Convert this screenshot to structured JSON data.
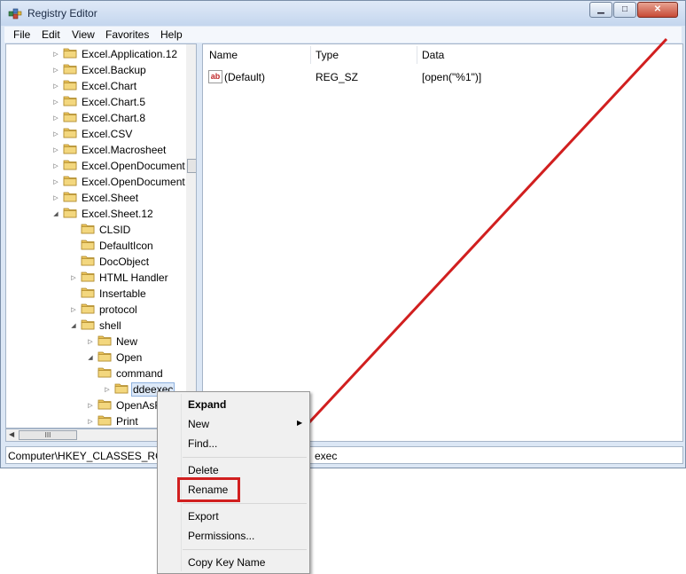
{
  "window": {
    "title": "Registry Editor"
  },
  "title_buttons": {
    "minimize": "▁",
    "maximize": "□",
    "close": "✕"
  },
  "menu": [
    "File",
    "Edit",
    "View",
    "Favorites",
    "Help"
  ],
  "tree": [
    {
      "label": "Excel.Application.12",
      "expander": "▷"
    },
    {
      "label": "Excel.Backup",
      "expander": "▷"
    },
    {
      "label": "Excel.Chart",
      "expander": "▷"
    },
    {
      "label": "Excel.Chart.5",
      "expander": "▷"
    },
    {
      "label": "Excel.Chart.8",
      "expander": "▷"
    },
    {
      "label": "Excel.CSV",
      "expander": "▷"
    },
    {
      "label": "Excel.Macrosheet",
      "expander": "▷"
    },
    {
      "label": "Excel.OpenDocument",
      "expander": "▷"
    },
    {
      "label": "Excel.OpenDocument",
      "expander": "▷"
    },
    {
      "label": "Excel.Sheet",
      "expander": "▷"
    },
    {
      "label": "Excel.Sheet.12",
      "expander": "◢"
    },
    {
      "label": "CLSID",
      "expander": ""
    },
    {
      "label": "DefaultIcon",
      "expander": ""
    },
    {
      "label": "DocObject",
      "expander": ""
    },
    {
      "label": "HTML Handler",
      "expander": "▷"
    },
    {
      "label": "Insertable",
      "expander": ""
    },
    {
      "label": "protocol",
      "expander": "▷"
    },
    {
      "label": "shell",
      "expander": "◢"
    },
    {
      "label": "New",
      "expander": "▷"
    },
    {
      "label": "Open",
      "expander": "◢"
    },
    {
      "label": "command",
      "expander": ""
    },
    {
      "label": "ddeexec",
      "expander": "▷",
      "selected": true
    },
    {
      "label": "OpenAsR",
      "expander": "▷"
    },
    {
      "label": "Print",
      "expander": "▷"
    }
  ],
  "hscroll_thumb": "III",
  "values_pane": {
    "headers": {
      "name": "Name",
      "type": "Type",
      "data": "Data"
    },
    "rows": [
      {
        "icon": "ab",
        "name": "(Default)",
        "type": "REG_SZ",
        "data": "[open(\"%1\")]"
      }
    ]
  },
  "statusbar": {
    "left": "Computer\\HKEY_CLASSES_ROO",
    "right": "exec"
  },
  "context_menu": {
    "expand": "Expand",
    "new": "New",
    "new_arrow": "▶",
    "find": "Find...",
    "delete": "Delete",
    "rename": "Rename",
    "export": "Export",
    "permissions": "Permissions...",
    "copy_key_name": "Copy Key Name"
  },
  "colors": {
    "annotation_red": "#d11f1f",
    "folder_yellow": "#e9c25a"
  }
}
